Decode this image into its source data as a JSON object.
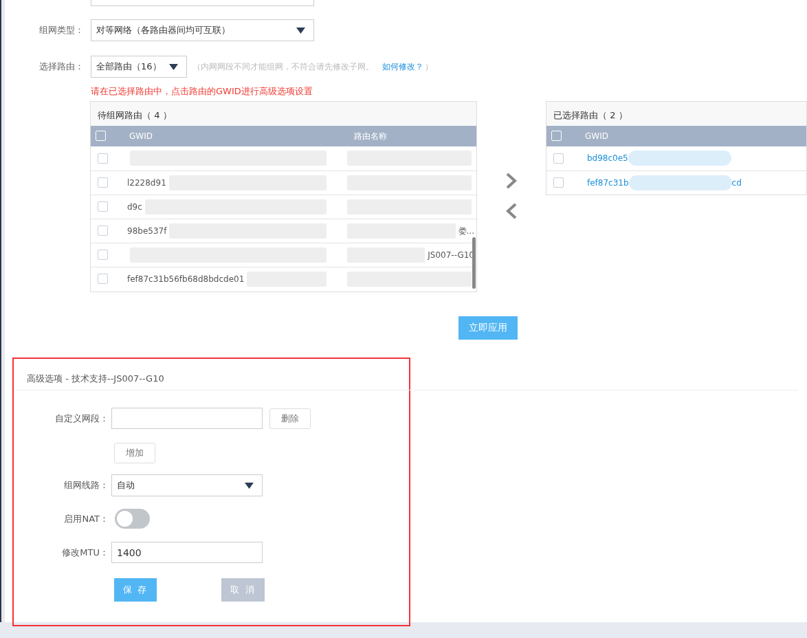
{
  "network_type": {
    "label": "组网类型：",
    "value": "对等网络（各路由器间均可互联）"
  },
  "route_select": {
    "label": "选择路由：",
    "value": "全部路由（16）",
    "hint": "（内网网段不同才能组网，不符合请先修改子网。",
    "link": "如何修改？",
    "hint_end": "）"
  },
  "notice": "请在已选择路由中，点击路由的GWID进行高级选项设置",
  "pending_table": {
    "title": "待组网路由（ 4 ）",
    "all_checked": false,
    "columns": [
      "GWID",
      "路由名称"
    ],
    "rows": [
      {
        "checked": false
      },
      {
        "checked": false,
        "gwid": "l2228d91"
      },
      {
        "checked": false,
        "gwid": "d9c"
      },
      {
        "checked": false,
        "gwid": "98be537f",
        "name": "娄..."
      },
      {
        "checked": false,
        "name": "JS007--G10"
      },
      {
        "checked": false,
        "gwid": "fef87c31b56fb68d8bdcde01"
      }
    ]
  },
  "selected_table": {
    "title": "已选择路由（ 2 ）",
    "all_checked": false,
    "columns": [
      "GWID"
    ],
    "rows": [
      {
        "checked": false,
        "gwid": "bd98c0e5"
      },
      {
        "checked": false,
        "gwid": "fef87c31b",
        "gwid_end": "cd"
      }
    ]
  },
  "apply_button": "立即应用",
  "advanced": {
    "title": "高级选项 - 技术支持--JS007--G10",
    "custom_segment": {
      "label": "自定义网段：",
      "delete": "删除",
      "add": "增加"
    },
    "line": {
      "label": "组网线路：",
      "value": "自动"
    },
    "nat": {
      "label": "启用NAT：",
      "on": false
    },
    "mtu": {
      "label": "修改MTU：",
      "value": "1400"
    },
    "save": "保 存",
    "cancel": "取 消"
  }
}
